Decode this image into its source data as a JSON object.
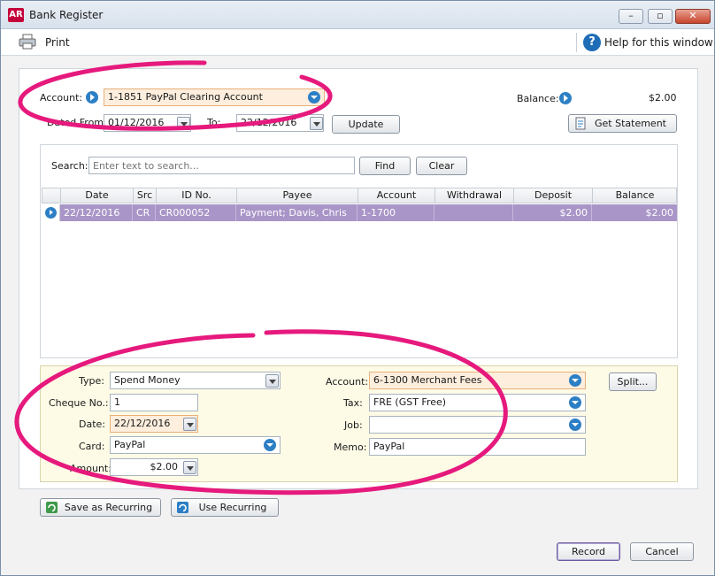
{
  "window": {
    "app_badge": "AR",
    "title": "Bank Register"
  },
  "toolbar": {
    "print_label": "Print",
    "help_label": "Help for this window"
  },
  "header": {
    "account_label": "Account:",
    "account_value": "1-1851 PayPal Clearing Account",
    "balance_label": "Balance:",
    "balance_value": "$2.00",
    "dated_from_label": "Dated From:",
    "dated_from_value": "01/12/2016",
    "to_label": "To:",
    "to_value": "22/12/2016",
    "update_button": "Update",
    "get_statement_button": "Get Statement"
  },
  "search": {
    "label": "Search:",
    "placeholder": "Enter text to search...",
    "find_button": "Find",
    "clear_button": "Clear"
  },
  "table": {
    "columns": [
      "Date",
      "Src",
      "ID No.",
      "Payee",
      "Account",
      "Withdrawal",
      "Deposit",
      "Balance"
    ],
    "rows": [
      {
        "date": "22/12/2016",
        "src": "CR",
        "id_no": "CR000052",
        "payee": "Payment; Davis, Chris",
        "account": "1-1700",
        "withdrawal": "",
        "deposit": "$2.00",
        "balance": "$2.00"
      }
    ]
  },
  "detail": {
    "type_label": "Type:",
    "type_value": "Spend Money",
    "cheque_label": "Cheque No.:",
    "cheque_value": "1",
    "date_label": "Date:",
    "date_value": "22/12/2016",
    "card_label": "Card:",
    "card_value": "PayPal",
    "amount_label": "Amount:",
    "amount_value": "$2.00",
    "account_label": "Account:",
    "account_value": "6-1300 Merchant Fees",
    "tax_label": "Tax:",
    "tax_value": "FRE (GST Free)",
    "job_label": "Job:",
    "job_value": "",
    "memo_label": "Memo:",
    "memo_value": "PayPal",
    "split_button": "Split..."
  },
  "footer": {
    "save_recurring": "Save as Recurring",
    "use_recurring": "Use Recurring",
    "record": "Record",
    "cancel": "Cancel"
  },
  "colors": {
    "selected_row": "#a995c7",
    "highlight_field": "#fdeedd",
    "detail_panel": "#fdfbe6",
    "annotation": "#e6197d",
    "link_blue": "#2c7fc5"
  }
}
